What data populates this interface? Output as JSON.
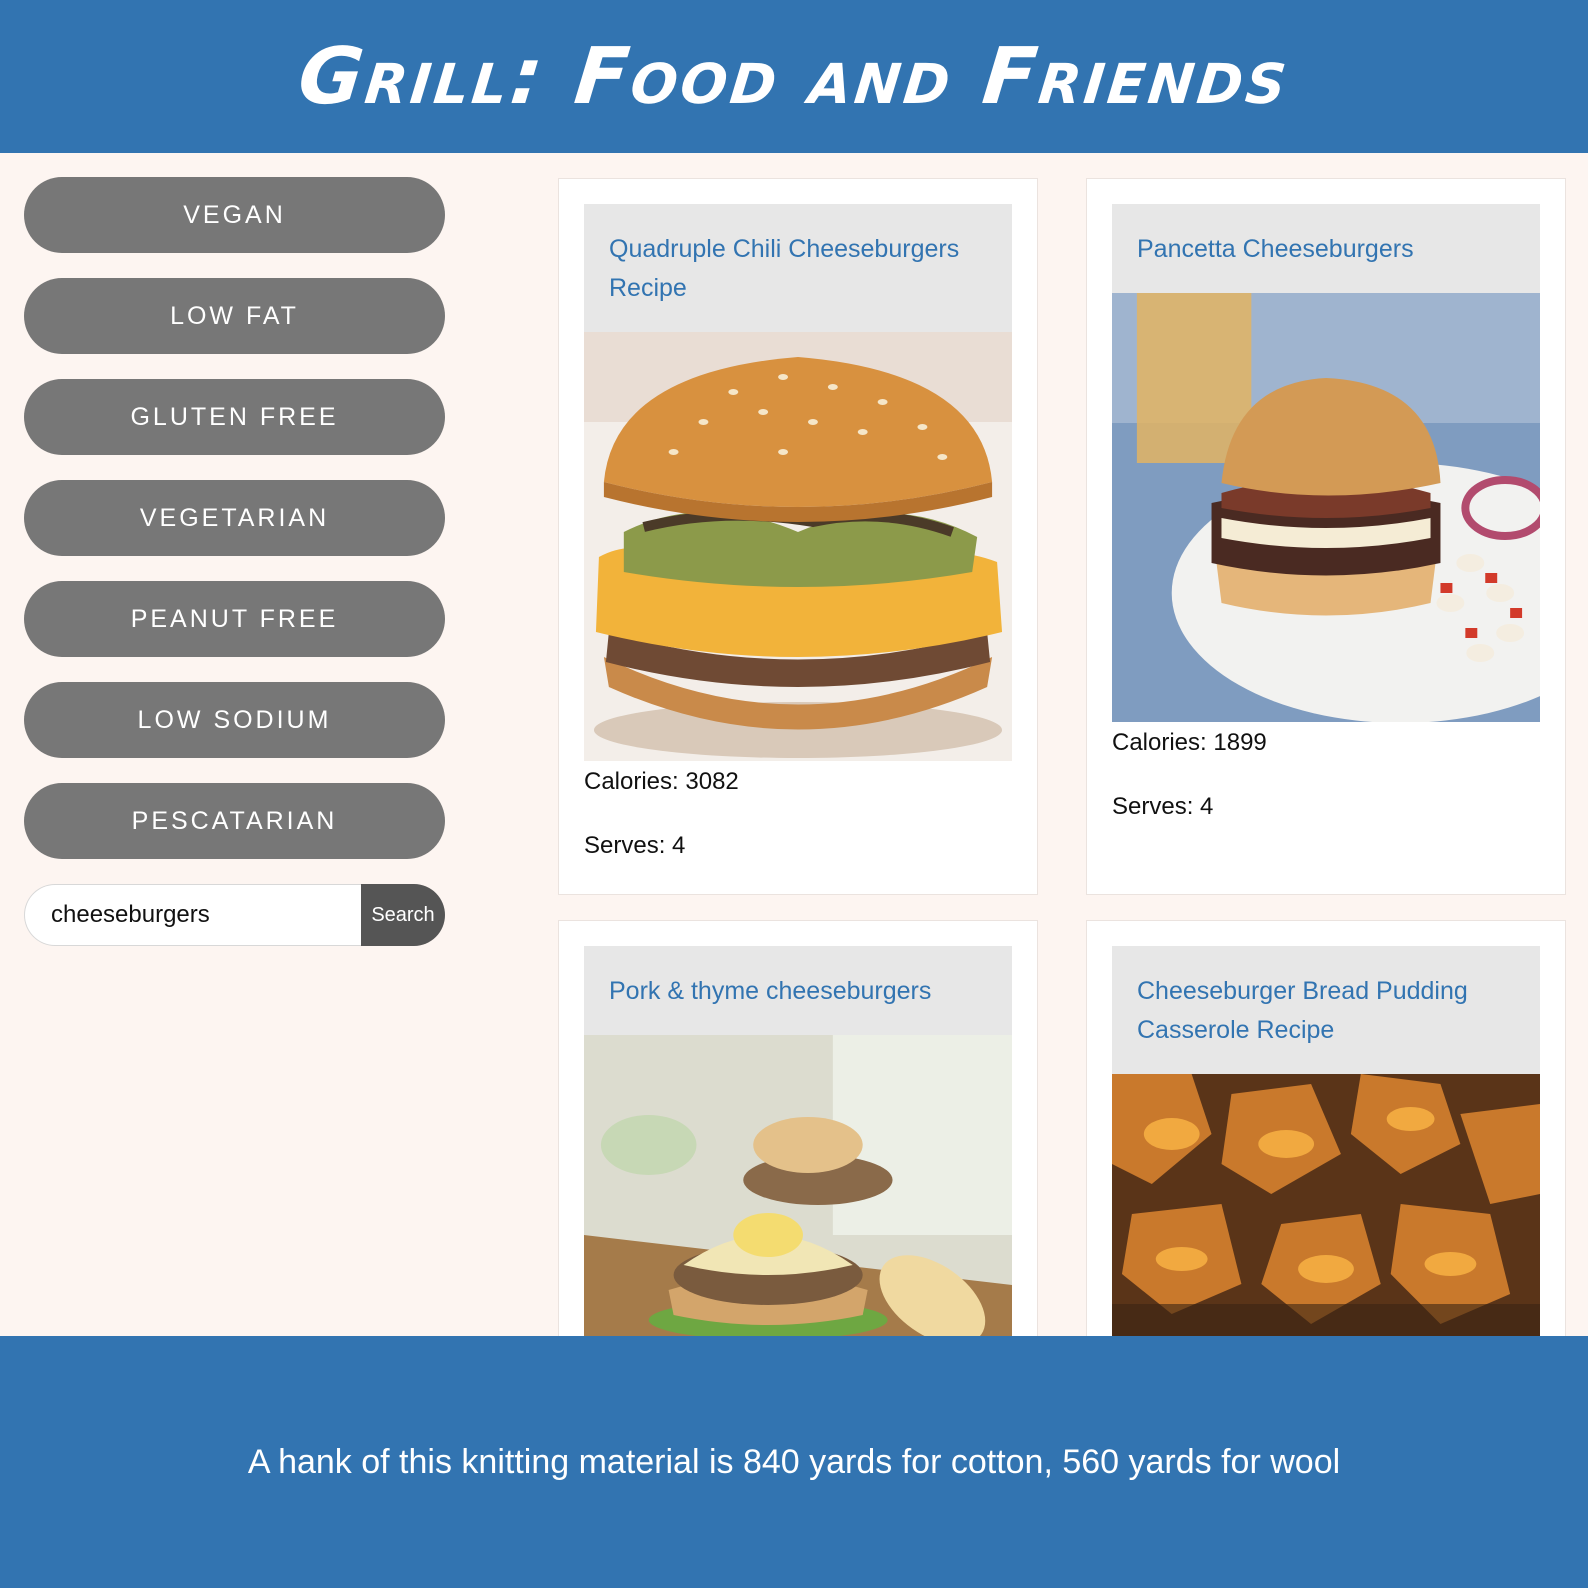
{
  "header": {
    "title": "Grill: Food and Friends"
  },
  "sidebar": {
    "filters": [
      {
        "label": "VEGAN"
      },
      {
        "label": "LOW FAT"
      },
      {
        "label": "GLUTEN FREE"
      },
      {
        "label": "VEGETARIAN"
      },
      {
        "label": "PEANUT FREE"
      },
      {
        "label": "LOW SODIUM"
      },
      {
        "label": "PESCATARIAN"
      }
    ],
    "search": {
      "value": "cheeseburgers",
      "button_label": "Search"
    }
  },
  "recipes": [
    {
      "title": "Quadruple Chili Cheeseburgers Recipe",
      "calories": "Calories: 3082",
      "serves": "Serves: 4",
      "image": "burger-chili-photo"
    },
    {
      "title": "Pancetta Cheeseburgers",
      "calories": "Calories: 1899",
      "serves": "Serves: 4",
      "image": "burger-pancetta-photo"
    },
    {
      "title": "Pork & thyme cheeseburgers",
      "image": "burger-pork-thyme-photo"
    },
    {
      "title": "Cheeseburger Bread Pudding Casserole Recipe",
      "image": "bread-pudding-casserole-photo"
    }
  ],
  "footer": {
    "text": "A hank of this knitting material is 840 yards for cotton, 560 yards for wool"
  },
  "colors": {
    "brand_blue": "#3274b1",
    "button_gray": "#777777",
    "page_bg": "#fdf5f1",
    "title_box": "#e7e7e7"
  }
}
